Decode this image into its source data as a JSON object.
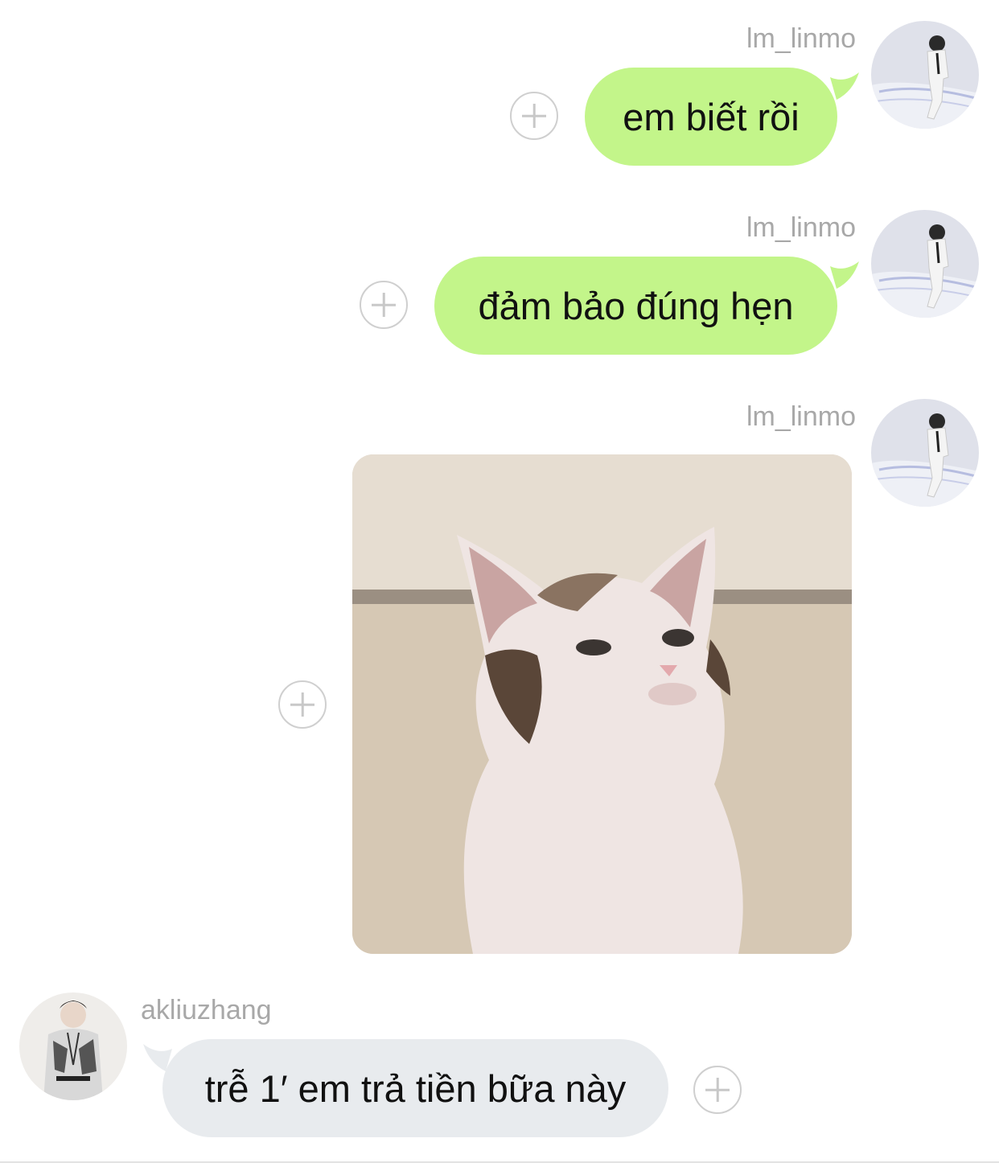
{
  "messages": [
    {
      "sender": "lm_linmo",
      "type": "text",
      "text": "em biết rồi",
      "direction": "outgoing"
    },
    {
      "sender": "lm_linmo",
      "type": "text",
      "text": "đảm bảo đúng hẹn",
      "direction": "outgoing"
    },
    {
      "sender": "lm_linmo",
      "type": "image",
      "image_desc": "cat-meme",
      "direction": "outgoing"
    },
    {
      "sender": "akliuzhang",
      "type": "text",
      "text": "trễ 1′ em trả tiền bữa này",
      "direction": "incoming"
    }
  ],
  "colors": {
    "outgoing_bubble": "#c3f58a",
    "incoming_bubble": "#e8ebee",
    "username": "#a8a8a8",
    "background": "#ffffff"
  },
  "icons": [
    "plus-circle-icon"
  ]
}
